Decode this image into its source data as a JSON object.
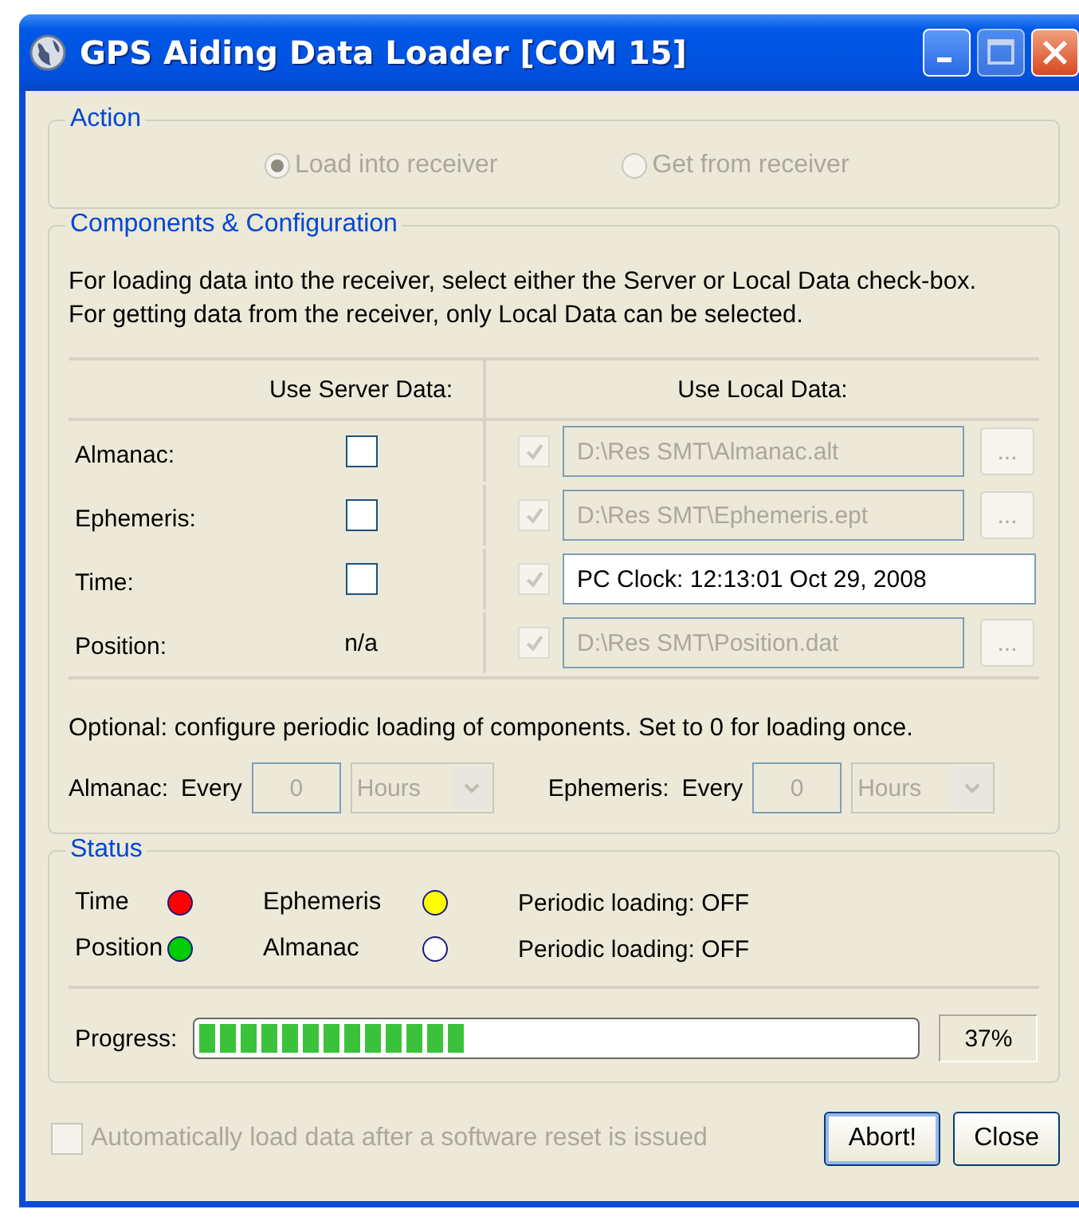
{
  "window": {
    "title": "GPS Aiding Data Loader [COM 15]"
  },
  "action": {
    "label": "Action",
    "options": [
      {
        "label": "Load into receiver",
        "selected": true,
        "disabled": true
      },
      {
        "label": "Get from receiver",
        "selected": false,
        "disabled": true
      }
    ]
  },
  "components": {
    "label": "Components & Configuration",
    "description": "For loading data into the receiver, select either the Server or Local Data check-box. For getting data from the receiver, only Local Data can be selected.",
    "columns": [
      "Use Server Data:",
      "Use Local Data:"
    ],
    "rows": [
      {
        "label": "Almanac:",
        "server": {
          "kind": "checkbox",
          "checked": false
        },
        "local": {
          "checked": true,
          "disabled": true
        },
        "path": {
          "value": "D:\\Res SMT\\Almanac.alt",
          "disabled": true
        },
        "browse": {
          "label": "...",
          "disabled": true
        }
      },
      {
        "label": "Ephemeris:",
        "server": {
          "kind": "checkbox",
          "checked": false
        },
        "local": {
          "checked": true,
          "disabled": true
        },
        "path": {
          "value": "D:\\Res SMT\\Ephemeris.ept",
          "disabled": true
        },
        "browse": {
          "label": "...",
          "disabled": true
        }
      },
      {
        "label": "Time:",
        "server": {
          "kind": "checkbox",
          "checked": false
        },
        "local": {
          "checked": true,
          "disabled": true
        },
        "path": {
          "value": "PC Clock: 12:13:01  Oct 29, 2008",
          "disabled": false
        }
      },
      {
        "label": "Position:",
        "server": {
          "kind": "text",
          "text": "n/a"
        },
        "local": {
          "checked": true,
          "disabled": true
        },
        "path": {
          "value": "D:\\Res SMT\\Position.dat",
          "disabled": true
        },
        "browse": {
          "label": "...",
          "disabled": true
        }
      }
    ],
    "periodic_note": "Optional: configure periodic loading of components. Set to 0 for loading once.",
    "periodic": [
      {
        "label": "Almanac:",
        "every": "Every",
        "value": "0",
        "unit": "Hours",
        "disabled": true
      },
      {
        "label": "Ephemeris:",
        "every": "Every",
        "value": "0",
        "unit": "Hours",
        "disabled": true
      }
    ]
  },
  "status": {
    "label": "Status",
    "rows": [
      {
        "items": [
          {
            "name": "Time",
            "color": "#ff0000"
          },
          {
            "name": "Ephemeris",
            "color": "#ffff00"
          }
        ],
        "periodic": "Periodic loading: OFF"
      },
      {
        "items": [
          {
            "name": "Position",
            "color": "#00cc00"
          },
          {
            "name": "Almanac",
            "color": "#ffffff"
          }
        ],
        "periodic": "Periodic loading: OFF"
      }
    ],
    "progress": {
      "label": "Progress:",
      "level": 0.37,
      "reading": "37%"
    }
  },
  "auto_load": {
    "label": "Automatically load data after a software reset is issued",
    "checked": false,
    "disabled": true
  },
  "buttons": [
    {
      "label": "Abort!",
      "default": true
    },
    {
      "label": "Close",
      "default": false
    }
  ]
}
